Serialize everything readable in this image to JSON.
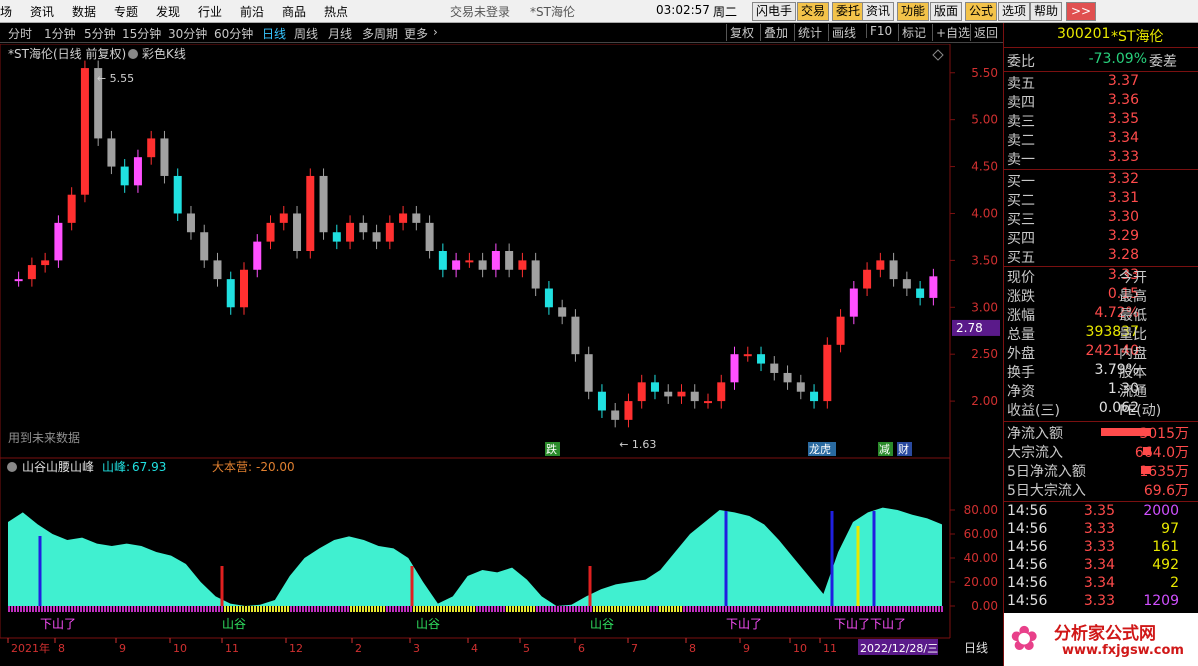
{
  "menu": {
    "items": [
      "场",
      "资讯",
      "数据",
      "专题",
      "发现",
      "行业",
      "前沿",
      "商品",
      "热点"
    ],
    "status": "交易未登录",
    "stock_title": "*ST海伦",
    "time": "03:02:57",
    "weekday": "周二",
    "tools": [
      "闪电手",
      "交易",
      "委托",
      "资讯",
      "功能",
      "版面",
      "公式",
      "选项",
      "帮助"
    ],
    "nav": ">>"
  },
  "periods": {
    "items": [
      "分时",
      "1分钟",
      "5分钟",
      "15分钟",
      "30分钟",
      "60分钟",
      "日线",
      "周线",
      "月线",
      "多周期",
      "更多"
    ],
    "active": "日线",
    "more_arrow": "›",
    "buttons": [
      "复权",
      "叠加",
      "统计",
      "画线",
      "F10",
      "标记",
      "+自选",
      "返回"
    ]
  },
  "main_chart": {
    "title": "*ST海伦(日线 前复权)",
    "kline_style": "彩色K线",
    "high_label": "5.55",
    "low_label": "1.63",
    "future_data": "用到未来数据",
    "price_tag": "2.78",
    "y_ticks": [
      "5.50",
      "5.00",
      "4.50",
      "4.00",
      "3.50",
      "3.00",
      "2.50",
      "2.00"
    ],
    "markers": [
      "跌",
      "龙虎",
      "减",
      "财"
    ]
  },
  "indicator": {
    "name": "山谷山腰山峰",
    "param_label": "山峰:",
    "param_value": "67.93",
    "param2_label": "大本营:",
    "param2_value": "-20.00",
    "y_ticks": [
      "80.00",
      "60.00",
      "40.00",
      "20.00",
      "0.00"
    ],
    "labels": [
      "下山了",
      "山谷",
      "山谷",
      "山谷",
      "下山了",
      "下山了",
      "下山了"
    ]
  },
  "dates": {
    "items": [
      "2021年",
      "8",
      "9",
      "10",
      "11",
      "12",
      "2",
      "3",
      "4",
      "5",
      "6",
      "7",
      "8",
      "9",
      "10",
      "11"
    ],
    "highlight": "2022/12/28/三",
    "period": "日线"
  },
  "quote": {
    "code": "300201",
    "name": "*ST海伦",
    "weibi_label": "委比",
    "weibi": "-73.09%",
    "weicha_label": "委差",
    "asks": [
      {
        "label": "卖五",
        "price": "3.37"
      },
      {
        "label": "卖四",
        "price": "3.36"
      },
      {
        "label": "卖三",
        "price": "3.35"
      },
      {
        "label": "卖二",
        "price": "3.34"
      },
      {
        "label": "卖一",
        "price": "3.33"
      }
    ],
    "bids": [
      {
        "label": "买一",
        "price": "3.32"
      },
      {
        "label": "买二",
        "price": "3.31"
      },
      {
        "label": "买三",
        "price": "3.30"
      },
      {
        "label": "买四",
        "price": "3.29"
      },
      {
        "label": "买五",
        "price": "3.28"
      }
    ],
    "stats": [
      {
        "l": "现价",
        "v": "3.33",
        "r": "今开"
      },
      {
        "l": "涨跌",
        "v": "0.15",
        "r": "最高"
      },
      {
        "l": "涨幅",
        "v": "4.72%",
        "r": "最低"
      },
      {
        "l": "总量",
        "v": "393837",
        "r": "量比"
      },
      {
        "l": "外盘",
        "v": "242140",
        "r": "内盘"
      },
      {
        "l": "换手",
        "v": "3.79%",
        "r": "股本"
      },
      {
        "l": "净资",
        "v": "1.30",
        "r": "流通"
      },
      {
        "l": "收益(三)",
        "v": "0.062",
        "r": "PE(动)"
      }
    ],
    "flows": [
      {
        "l": "净流入额",
        "v": "3015万"
      },
      {
        "l": "大宗流入",
        "v": "664.0万"
      },
      {
        "l": "5日净流入额",
        "v": "1635万"
      },
      {
        "l": "5日大宗流入",
        "v": "69.6万"
      }
    ],
    "ticks": [
      {
        "t": "14:56",
        "p": "3.35",
        "q": "2000"
      },
      {
        "t": "14:56",
        "p": "3.33",
        "q": "97"
      },
      {
        "t": "14:56",
        "p": "3.33",
        "q": "161"
      },
      {
        "t": "14:56",
        "p": "3.34",
        "q": "492"
      },
      {
        "t": "14:56",
        "p": "3.34",
        "q": "2"
      },
      {
        "t": "14:56",
        "p": "3.33",
        "q": "1209"
      }
    ]
  },
  "watermark": {
    "brand": "分析家公式网",
    "url": "www.fxjgsw.com"
  },
  "chart_data": {
    "type": "line",
    "title": "*ST海伦(日线 前复权)",
    "ylim": [
      1.5,
      5.7
    ],
    "series": [
      {
        "name": "",
        "values": [
          3.3,
          3.45,
          3.5,
          3.9,
          4.2,
          5.55,
          4.8,
          4.5,
          4.3,
          4.6,
          4.8,
          4.4,
          4.0,
          3.8,
          3.5,
          3.3,
          3.0,
          3.4,
          3.7,
          3.9,
          4.0,
          3.6,
          4.4,
          3.8,
          3.7,
          3.9,
          3.8,
          3.7,
          3.9,
          4.0,
          3.9,
          3.6,
          3.4,
          3.5,
          3.5,
          3.4,
          3.6,
          3.4,
          3.5,
          3.2,
          3.0,
          2.9,
          2.5,
          2.1,
          1.9,
          1.8,
          2.0,
          2.2,
          2.1,
          2.05,
          2.1,
          2.0,
          2.0,
          2.2,
          2.5,
          2.5,
          2.4,
          2.3,
          2.2,
          2.1,
          2.0,
          2.6,
          2.9,
          3.2,
          3.4,
          3.5,
          3.3,
          3.2,
          3.1,
          3.33
        ]
      }
    ]
  }
}
